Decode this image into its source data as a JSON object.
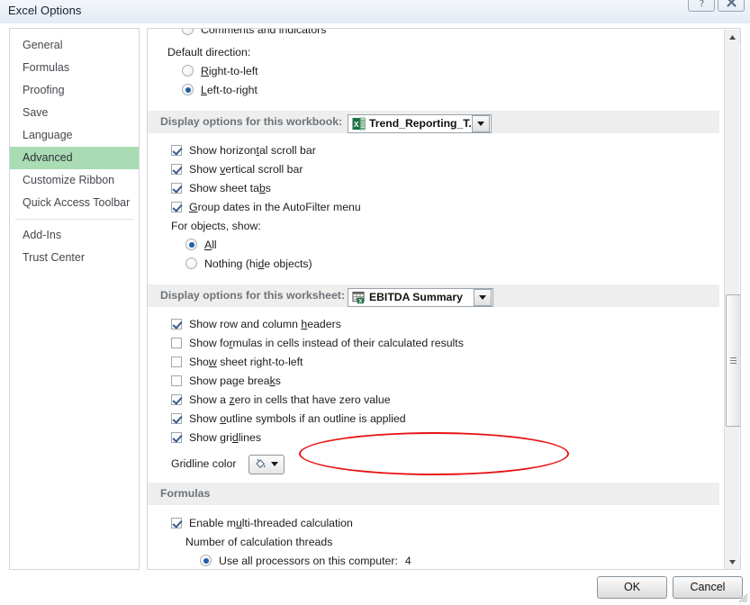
{
  "window": {
    "title": "Excel Options",
    "help_icon": "help-icon",
    "close_icon": "close-icon"
  },
  "sidebar": {
    "items": [
      {
        "label": "General",
        "active": false
      },
      {
        "label": "Formulas",
        "active": false
      },
      {
        "label": "Proofing",
        "active": false
      },
      {
        "label": "Save",
        "active": false
      },
      {
        "label": "Language",
        "active": false
      },
      {
        "label": "Advanced",
        "active": true
      },
      {
        "label": "Customize Ribbon",
        "active": false
      },
      {
        "label": "Quick Access Toolbar",
        "active": false
      },
      {
        "label": "Add-Ins",
        "active": false
      },
      {
        "label": "Trust Center",
        "active": false
      }
    ],
    "active_color": "#aadcb4"
  },
  "content": {
    "cutoff_top_option": "Comments and indicators",
    "default_direction": {
      "label": "Default direction:",
      "options": [
        {
          "label": "Right-to-left",
          "selected": false
        },
        {
          "label": "Left-to-right",
          "selected": true
        }
      ]
    },
    "workbook_section": {
      "header": "Display options for this workbook:",
      "selected_workbook": "Trend_Reporting_T...",
      "workbook_icon": "excel-workbook-icon",
      "checkboxes": [
        {
          "label": "Show horizontal scroll bar",
          "checked": true
        },
        {
          "label": "Show vertical scroll bar",
          "checked": true
        },
        {
          "label": "Show sheet tabs",
          "checked": true
        },
        {
          "label": "Group dates in the AutoFilter menu",
          "checked": true
        }
      ],
      "objects_label": "For objects, show:",
      "objects_options": [
        {
          "label": "All",
          "selected": true
        },
        {
          "label": "Nothing (hide objects)",
          "selected": false
        }
      ]
    },
    "worksheet_section": {
      "header": "Display options for this worksheet:",
      "selected_worksheet": "EBITDA Summary",
      "worksheet_icon": "excel-worksheet-icon",
      "checkboxes": [
        {
          "label": "Show row and column headers",
          "checked": true
        },
        {
          "label": "Show formulas in cells instead of their calculated results",
          "checked": false
        },
        {
          "label": "Show sheet right-to-left",
          "checked": false
        },
        {
          "label": "Show page breaks",
          "checked": false
        },
        {
          "label": "Show a zero in cells that have zero value",
          "checked": true
        },
        {
          "label": "Show outline symbols if an outline is applied",
          "checked": true,
          "annotated": true
        },
        {
          "label": "Show gridlines",
          "checked": true
        }
      ],
      "gridline_color_label": "Gridline color",
      "gridline_color_icon": "paint-bucket-icon"
    },
    "formulas_section": {
      "header": "Formulas",
      "enable_multithread": {
        "label": "Enable multi-threaded calculation",
        "checked": true
      },
      "threads_label": "Number of calculation threads",
      "processors_option": {
        "label": "Use all processors on this computer:",
        "selected": true,
        "value": "4"
      }
    },
    "annotation": {
      "shape": "red-ellipse",
      "color": "#e81313",
      "targets": "Show outline symbols if an outline is applied"
    }
  },
  "footer": {
    "ok_label": "OK",
    "cancel_label": "Cancel"
  },
  "scrollbar": {
    "up_icon": "scroll-up-icon",
    "down_icon": "scroll-down-icon",
    "thumb": "scroll-thumb"
  }
}
